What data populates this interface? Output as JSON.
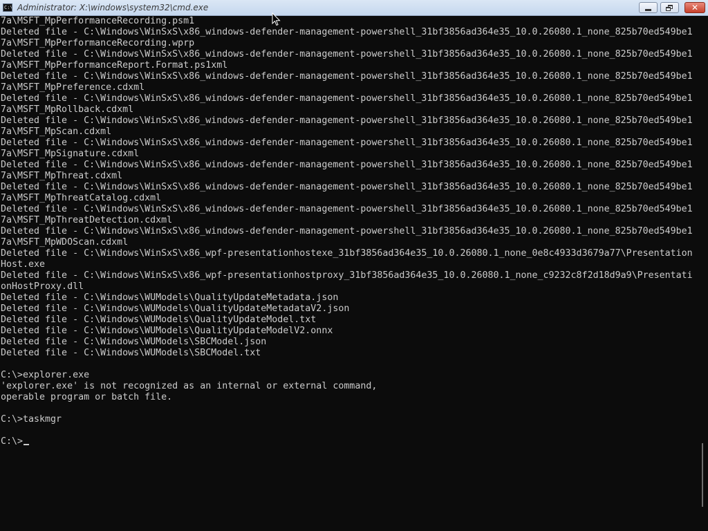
{
  "window": {
    "title": "Administrator: X:\\windows\\system32\\cmd.exe",
    "icon_label": "C:\\",
    "controls": {
      "minimize_icon": "minimize-icon",
      "restore_icon": "restore-icon",
      "close_icon": "close-icon",
      "close_glyph": "✕"
    }
  },
  "console": {
    "lines": [
      "7a\\MSFT_MpPerformanceRecording.psm1",
      "Deleted file - C:\\Windows\\WinSxS\\x86_windows-defender-management-powershell_31bf3856ad364e35_10.0.26080.1_none_825b70ed549be1",
      "7a\\MSFT_MpPerformanceRecording.wprp",
      "Deleted file - C:\\Windows\\WinSxS\\x86_windows-defender-management-powershell_31bf3856ad364e35_10.0.26080.1_none_825b70ed549be1",
      "7a\\MSFT_MpPerformanceReport.Format.ps1xml",
      "Deleted file - C:\\Windows\\WinSxS\\x86_windows-defender-management-powershell_31bf3856ad364e35_10.0.26080.1_none_825b70ed549be1",
      "7a\\MSFT_MpPreference.cdxml",
      "Deleted file - C:\\Windows\\WinSxS\\x86_windows-defender-management-powershell_31bf3856ad364e35_10.0.26080.1_none_825b70ed549be1",
      "7a\\MSFT_MpRollback.cdxml",
      "Deleted file - C:\\Windows\\WinSxS\\x86_windows-defender-management-powershell_31bf3856ad364e35_10.0.26080.1_none_825b70ed549be1",
      "7a\\MSFT_MpScan.cdxml",
      "Deleted file - C:\\Windows\\WinSxS\\x86_windows-defender-management-powershell_31bf3856ad364e35_10.0.26080.1_none_825b70ed549be1",
      "7a\\MSFT_MpSignature.cdxml",
      "Deleted file - C:\\Windows\\WinSxS\\x86_windows-defender-management-powershell_31bf3856ad364e35_10.0.26080.1_none_825b70ed549be1",
      "7a\\MSFT_MpThreat.cdxml",
      "Deleted file - C:\\Windows\\WinSxS\\x86_windows-defender-management-powershell_31bf3856ad364e35_10.0.26080.1_none_825b70ed549be1",
      "7a\\MSFT_MpThreatCatalog.cdxml",
      "Deleted file - C:\\Windows\\WinSxS\\x86_windows-defender-management-powershell_31bf3856ad364e35_10.0.26080.1_none_825b70ed549be1",
      "7a\\MSFT_MpThreatDetection.cdxml",
      "Deleted file - C:\\Windows\\WinSxS\\x86_windows-defender-management-powershell_31bf3856ad364e35_10.0.26080.1_none_825b70ed549be1",
      "7a\\MSFT_MpWDOScan.cdxml",
      "Deleted file - C:\\Windows\\WinSxS\\x86_wpf-presentationhostexe_31bf3856ad364e35_10.0.26080.1_none_0e8c4933d3679a77\\Presentation",
      "Host.exe",
      "Deleted file - C:\\Windows\\WinSxS\\x86_wpf-presentationhostproxy_31bf3856ad364e35_10.0.26080.1_none_c9232c8f2d18d9a9\\Presentati",
      "onHostProxy.dll",
      "Deleted file - C:\\Windows\\WUModels\\QualityUpdateMetadata.json",
      "Deleted file - C:\\Windows\\WUModels\\QualityUpdateMetadataV2.json",
      "Deleted file - C:\\Windows\\WUModels\\QualityUpdateModel.txt",
      "Deleted file - C:\\Windows\\WUModels\\QualityUpdateModelV2.onnx",
      "Deleted file - C:\\Windows\\WUModels\\SBCModel.json",
      "Deleted file - C:\\Windows\\WUModels\\SBCModel.txt",
      "",
      "C:\\>explorer.exe",
      "'explorer.exe' is not recognized as an internal or external command,",
      "operable program or batch file.",
      "",
      "C:\\>taskmgr",
      ""
    ],
    "prompt": "C:\\>"
  }
}
